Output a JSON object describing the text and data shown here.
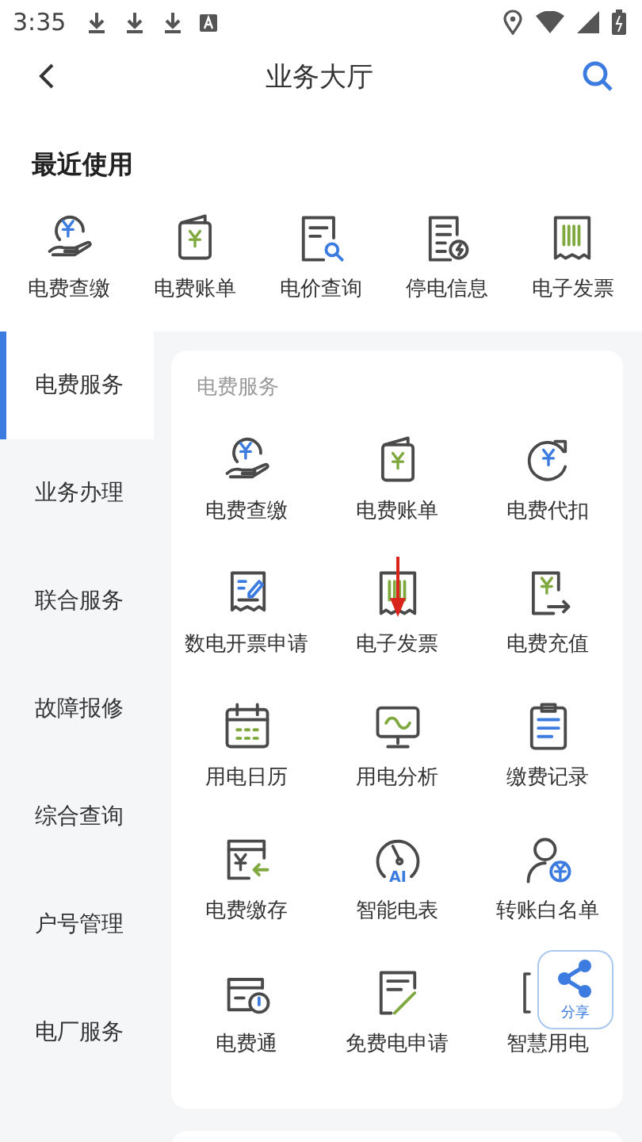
{
  "status_bar": {
    "time": "3:35"
  },
  "header": {
    "title": "业务大厅"
  },
  "recent": {
    "title": "最近使用",
    "items": [
      {
        "label": "电费查缴"
      },
      {
        "label": "电费账单"
      },
      {
        "label": "电价查询"
      },
      {
        "label": "停电信息"
      },
      {
        "label": "电子发票"
      }
    ]
  },
  "sidebar": {
    "items": [
      {
        "label": "电费服务",
        "selected": true
      },
      {
        "label": "业务办理",
        "selected": false
      },
      {
        "label": "联合服务",
        "selected": false
      },
      {
        "label": "故障报修",
        "selected": false
      },
      {
        "label": "综合查询",
        "selected": false
      },
      {
        "label": "户号管理",
        "selected": false
      },
      {
        "label": "电厂服务",
        "selected": false
      }
    ]
  },
  "section": {
    "title": "电费服务",
    "meter_icon_text": "AI",
    "items": [
      {
        "label": "电费查缴"
      },
      {
        "label": "电费账单"
      },
      {
        "label": "电费代扣"
      },
      {
        "label": "数电开票申请"
      },
      {
        "label": "电子发票"
      },
      {
        "label": "电费充值"
      },
      {
        "label": "用电日历"
      },
      {
        "label": "用电分析"
      },
      {
        "label": "缴费记录"
      },
      {
        "label": "电费缴存"
      },
      {
        "label": "智能电表"
      },
      {
        "label": "转账白名单"
      },
      {
        "label": "电费通"
      },
      {
        "label": "免费电申请"
      },
      {
        "label": "智慧用电"
      }
    ]
  },
  "share_button": {
    "label": "分享"
  }
}
